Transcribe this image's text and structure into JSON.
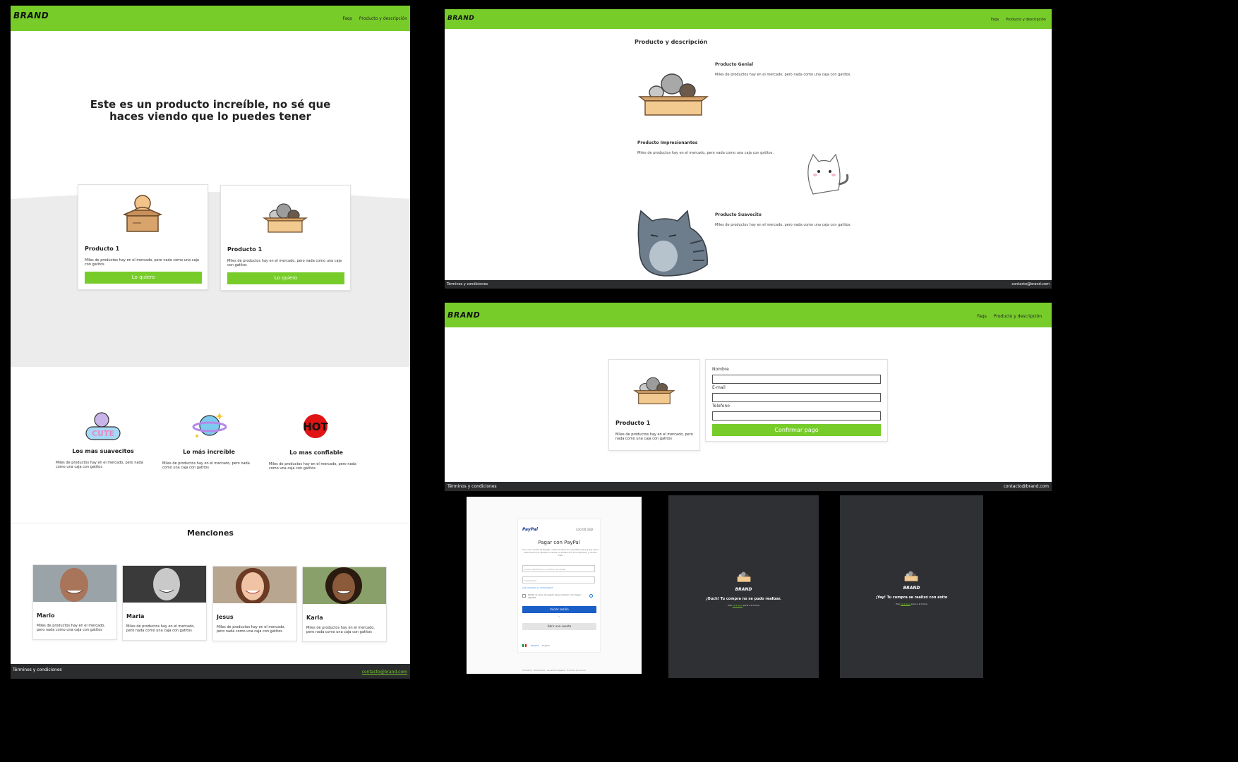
{
  "brand": "BRAND",
  "nav": {
    "faqs": "Faqs",
    "producto": "Producto y descripción"
  },
  "footer": {
    "terms": "Términos y condiciones",
    "email": "contacto@brand.com"
  },
  "home": {
    "hero_title": "Este es un producto increíble, no sé que haces viendo que lo puedes tener",
    "products": [
      {
        "title": "Producto 1",
        "desc": "Miles de productos hay en el mercado, pero nada como una caja con gatitos",
        "button": "Lo quiero"
      },
      {
        "title": "Producto 1",
        "desc": "Miles de productos hay en el mercado, pero nada como una caja con gatitos",
        "button": "Lo quiero"
      }
    ],
    "features": [
      {
        "title": "Los mas suavecitos",
        "desc": "Miles de productos hay en el mercado, pero nada como una caja con gatitos",
        "badge": "CUTE"
      },
      {
        "title": "Lo más increíble",
        "desc": "Miles de productos hay en el mercado, pero nada como una caja con gatitos"
      },
      {
        "title": "Lo mas confiable",
        "desc": "Miles de productos hay en el mercado, pero nada como una caja con gatitos",
        "badge": "HOT"
      }
    ],
    "mentions_title": "Menciones",
    "mentions": [
      {
        "name": "Mario",
        "desc": "Miles de productos hay en el mercado, pero nada como una caja con gatitos"
      },
      {
        "name": "Maria",
        "desc": "Miles de productos hay en el mercado, pero nada como una caja con gatitos"
      },
      {
        "name": "Jesus",
        "desc": "Miles de productos hay en el mercado, pero nada como una caja con gatitos"
      },
      {
        "name": "Karla",
        "desc": "Miles de productos hay en el mercado, pero nada como una caja con gatitos"
      }
    ]
  },
  "detail": {
    "title": "Producto y descripción",
    "items": [
      {
        "title": "Producto Genial",
        "desc": "Miles de productos hay en el mercado, pero nada como una caja con gatitos."
      },
      {
        "title": "Producto Impresionantes",
        "desc": "Miles de productos hay en el mercado, pero nada como una caja con gatitos."
      },
      {
        "title": "Producto Suavecito",
        "desc": "Miles de productos hay en el mercado, pero nada como una caja con gatitos."
      }
    ]
  },
  "checkout": {
    "product_title": "Producto 1",
    "product_desc": "Miles de productos hay en el mercado, pero nada como una caja con gatitos",
    "labels": {
      "name": "Nombre",
      "email": "E-mail",
      "phone": "Telefono"
    },
    "confirm": "Confirmar pago"
  },
  "paypal": {
    "logo": "PayPal",
    "amount": "$10.00 USD",
    "heading": "Pagar con PayPal",
    "intro": "Con una cuenta de Paypal, usted recibirá los requisitos para gozar de la Devolución por Nuestra Cuenta, la Protección al Comprador y mucho más.",
    "email_placeholder": "Correo electrónico o número de celular",
    "password_placeholder": "Contraseña",
    "forgot": "¿Ha olvidado su contraseña?",
    "remember": "Omitir el inicio de sesión para comprar con mayor rapidez",
    "login": "Iniciar sesión",
    "or": "o",
    "create": "Abrir una cuenta",
    "lang": "Español",
    "lang2": "English",
    "footer": "Contacto · Privacidad · Acuerdos legales · En todo el mundo"
  },
  "fail": {
    "brand": "BRAND",
    "message": "¡Ouch! Tu compra no se pudo realizar.",
    "sub_pre": "Haz ",
    "sub_link": "click aquí",
    "sub_post": " para ir al home"
  },
  "success": {
    "brand": "BRAND",
    "message": "¡Yay! Tu compra se realizó con éxito",
    "sub_pre": "Haz ",
    "sub_link": "click aquí",
    "sub_post": " para ir al home"
  },
  "colors": {
    "green": "#77cc2a",
    "dark": "#2b2c2e"
  }
}
